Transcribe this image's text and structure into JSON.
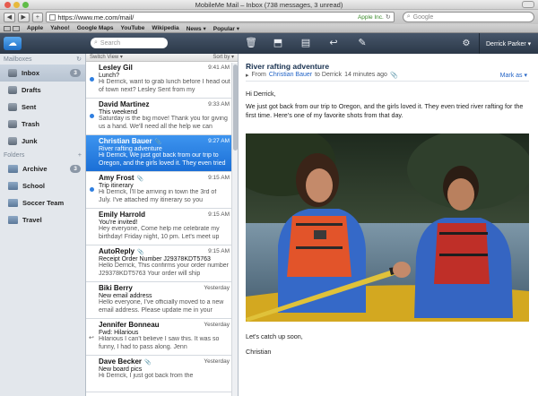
{
  "browser": {
    "window_title": "MobileMe Mail – Inbox (738 messages, 3 unread)",
    "url": "https://www.me.com/mail/",
    "secure_label": "Apple Inc.",
    "search_placeholder": "Google",
    "bookmarks": [
      "Apple",
      "Yahoo!",
      "Google Maps",
      "YouTube",
      "Wikipedia",
      "News ▾",
      "Popular ▾"
    ]
  },
  "app": {
    "search_placeholder": "Search",
    "user_name": "Derrick Parker ▾"
  },
  "sidebar": {
    "mailboxes_label": "Mailboxes",
    "folders_label": "Folders",
    "mailboxes": [
      {
        "label": "Inbox",
        "badge": "3"
      },
      {
        "label": "Drafts"
      },
      {
        "label": "Sent"
      },
      {
        "label": "Trash"
      },
      {
        "label": "Junk"
      }
    ],
    "folders": [
      {
        "label": "Archive",
        "badge": "3"
      },
      {
        "label": "School"
      },
      {
        "label": "Soccer Team"
      },
      {
        "label": "Travel"
      }
    ]
  },
  "list": {
    "switch_view": "Switch View ▾",
    "sort_by": "Sort by ▾",
    "messages": [
      {
        "from": "Lesley Gil",
        "time": "9:41 AM",
        "subject": "Lunch?",
        "preview": "Hi Derrick, want to grab lunch before I head out of town next? Lesley Sent from my",
        "unread": true
      },
      {
        "from": "David Martinez",
        "time": "9:33 AM",
        "subject": "This weekend",
        "preview": "Saturday is the big move! Thank you for giving us a hand. We'll need all the help we can",
        "unread": true
      },
      {
        "from": "Christian Bauer",
        "time": "9:27 AM",
        "subject": "River rafting adventure",
        "preview": "Hi Derrick, We just got back from our trip to Oregon, and the girls loved it. They even tried",
        "selected": true,
        "attachment": "📎"
      },
      {
        "from": "Amy Frost",
        "time": "9:15 AM",
        "subject": "Trip itinerary",
        "preview": "Hi Derrick, I'll be arriving in town the 3rd of July. I've attached my itinerary so you",
        "unread": true,
        "attachment": "📎"
      },
      {
        "from": "Emily Harrold",
        "time": "9:15 AM",
        "subject": "You're invited!",
        "preview": "Hey everyone, Come help me celebrate my birthday! Friday night, 10 pm. Let's meet up"
      },
      {
        "from": "AutoReply",
        "time": "9:15 AM",
        "subject": "Receipt Order Number J29378KDT5763",
        "preview": "Hello Derrick, This confirms your order number J29378KDT5763 Your order will ship",
        "attachment": "📎"
      },
      {
        "from": "Biki Berry",
        "time": "Yesterday",
        "subject": "New email address",
        "preview": "Hello everyone, I've officially moved to a new email address. Please update me in your Contacts."
      },
      {
        "from": "Jennifer Bonneau",
        "time": "Yesterday",
        "subject": "Fwd: Hilarious",
        "preview": "Hilarious I can't believe I saw this. It was so funny, I had to pass along. Jenn",
        "replied": true
      },
      {
        "from": "Dave Becker",
        "time": "Yesterday",
        "subject": "New board pics",
        "preview": "Hi Derrick, I just got back from the",
        "attachment": "📎"
      }
    ]
  },
  "reader": {
    "subject": "River rafting adventure",
    "from_label": "From",
    "sender": "Christian Bauer",
    "sent_time": "to Derrick",
    "sent_ago": "14 minutes ago",
    "mark_as": "Mark as ▾",
    "greeting": "Hi Derrick,",
    "paragraph": "We just got back from our trip to Oregon, and the girls loved it. They even tried river rafting for the first time. Here’s one of my favorite shots from that day.",
    "closing": "Let's catch up soon,",
    "signature": "Christian"
  },
  "colors": {
    "header_bg": "#2b3848",
    "selected_row": "#1b6fd6",
    "link_blue": "#2364c6",
    "unread_dot": "#2f7fe0"
  },
  "icons": {
    "toolbar": [
      "trash-icon",
      "archive-box-icon",
      "move-folder-icon",
      "reply-icon",
      "compose-icon",
      "gear-icon"
    ]
  }
}
